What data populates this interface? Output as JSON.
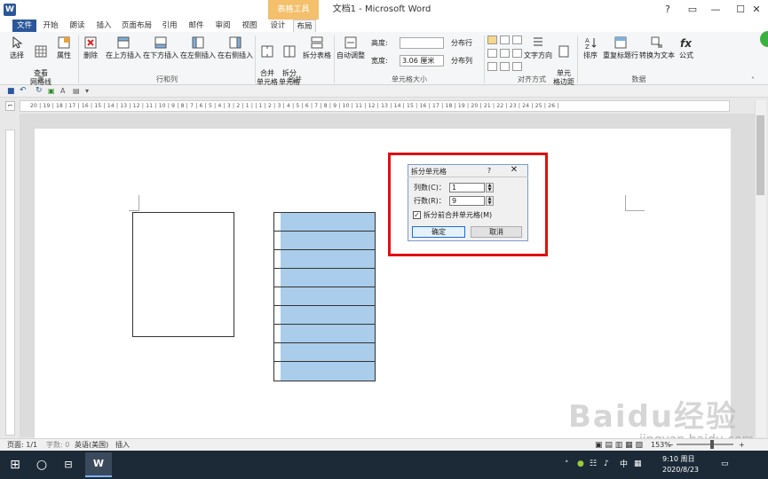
{
  "app": {
    "window_title": "文档1 - Microsoft Word",
    "app_icon_letter": "W",
    "contextual_tab": "表格工具"
  },
  "tabs": [
    "文件",
    "开始",
    "朗读",
    "插入",
    "页面布局",
    "引用",
    "邮件",
    "审阅",
    "视图",
    "设计",
    "布局"
  ],
  "ribbon": {
    "groups": {
      "table": {
        "label": "表",
        "buttons": [
          "选择",
          "查看\n网格线",
          "属性"
        ]
      },
      "rows_cols": {
        "label": "行和列",
        "buttons": [
          "删除",
          "在上方插入",
          "在下方插入",
          "在左侧插入",
          "在右侧插入"
        ]
      },
      "merge": {
        "label": "合并",
        "buttons": [
          "合并\n单元格",
          "拆分\n单元格",
          "拆分表格"
        ]
      },
      "cell_size": {
        "label": "单元格大小",
        "autofit": "自动调整",
        "height_label": "高度:",
        "height_value": "",
        "width_label": "宽度:",
        "width_value": "3.06 厘米",
        "distribute_rows": "分布行",
        "distribute_cols": "分布列"
      },
      "alignment": {
        "label": "对齐方式",
        "buttons": [
          "文字方向",
          "单元\n格边距"
        ]
      },
      "data": {
        "label": "数据",
        "buttons": [
          "排序",
          "重复标题行",
          "转换为文本",
          "公式"
        ]
      }
    }
  },
  "ruler_text": "20 | 19 | 18 | 17 | 16 | 15 | 14 | 13 | 12 | 11 | 10 | 9 | 8 | 7 | 6 | 5 | 4 | 3 | 2 | 1 |   | 1 | 2 | 3 | 4 | 5 | 6 | 7 | 8 | 9 | 10 | 11 | 12 | 13 | 14 | 15 | 16 | 17 | 18 | 19 | 20 | 21 | 22 | 23 | 24 | 25 | 26 |",
  "dialog": {
    "title": "拆分单元格",
    "help": "?",
    "close": "✕",
    "columns_label": "列数(C)：",
    "columns_value": "1",
    "rows_label": "行数(R)：",
    "rows_value": "9",
    "merge_before_split_label": "拆分前合并单元格(M)",
    "merge_before_split_checked": "✓",
    "ok": "确定",
    "cancel": "取消"
  },
  "statusbar": {
    "page": "页面: 1/1",
    "words": "字数: 0",
    "language": "英语(美国)",
    "mode": "插入",
    "zoom": "153%"
  },
  "taskbar": {
    "time": "9:10 周日",
    "date": "2020/8/23",
    "input_method": "中"
  },
  "watermark": {
    "text": "Baidu经验",
    "url": "jingyan.baidu.com"
  },
  "colors": {
    "accent": "#2b579a",
    "selection": "#a9cdea",
    "highlight": "#e01010",
    "contextual_tab": "#f4c06c"
  }
}
